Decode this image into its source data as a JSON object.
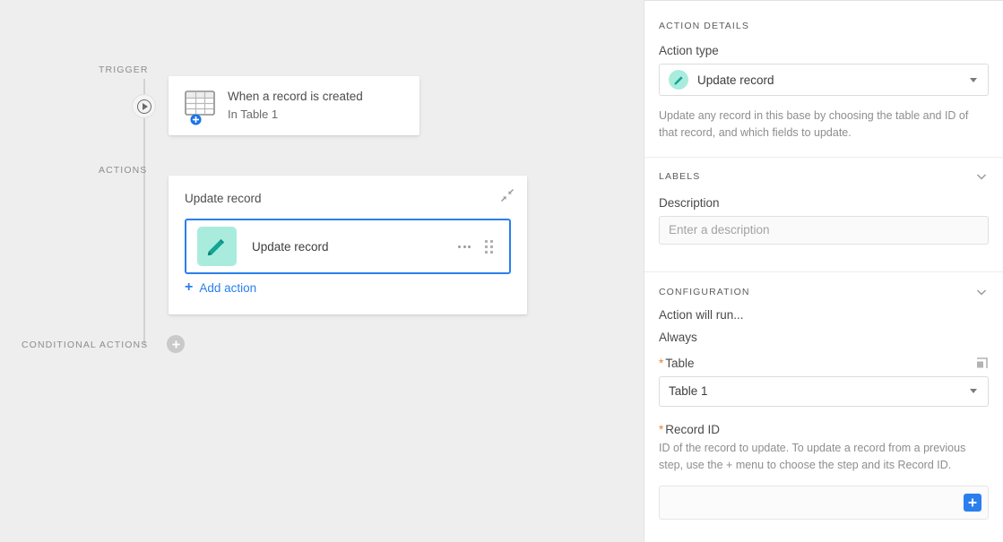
{
  "canvas": {
    "labels": {
      "trigger": "TRIGGER",
      "actions": "ACTIONS",
      "conditional_actions": "CONDITIONAL ACTIONS"
    },
    "trigger_card": {
      "title": "When a record is created",
      "subtitle": "In Table 1",
      "icon": "table-grid-icon",
      "badge_icon": "plus-badge-icon"
    },
    "action_group": {
      "title": "Update record",
      "collapse_icon": "collapse-diagonal-icon",
      "item": {
        "label": "Update record",
        "icon": "pencil-icon",
        "more_icon": "ellipsis-icon",
        "drag_icon": "drag-handle-icon"
      },
      "add_action_label": "Add action",
      "add_action_icon": "plus-icon"
    },
    "conditional_add_icon": "plus-circle-icon",
    "trigger_node_icon": "play-circle-icon"
  },
  "panel": {
    "action_details": {
      "heading": "ACTION DETAILS",
      "action_type_label": "Action type",
      "action_type_value": "Update record",
      "action_type_icon": "pencil-icon",
      "dropdown_icon": "chevron-down-icon",
      "description_text": "Update any record in this base by choosing the table and ID of that record, and which fields to update."
    },
    "labels_section": {
      "heading": "LABELS",
      "collapse_icon": "chevron-down-icon",
      "description_label": "Description",
      "description_value": "",
      "description_placeholder": "Enter a description"
    },
    "configuration": {
      "heading": "CONFIGURATION",
      "collapse_icon": "chevron-down-icon",
      "action_will_run_label": "Action will run...",
      "action_will_run_value": "Always",
      "table_label": "Table",
      "table_required_marker": "*",
      "table_value": "Table 1",
      "table_expand_icon": "external-expand-icon",
      "record_id_label": "Record ID",
      "record_id_required_marker": "*",
      "record_id_help": "ID of the record to update. To update a record from a previous step, use the + menu to choose the step and its Record ID.",
      "record_id_value": "",
      "record_id_plus_icon": "plus-icon"
    }
  },
  "colors": {
    "accent_blue": "#2a7fee",
    "teal": "#1aab95",
    "mint": "#a9ecdd",
    "required_orange": "#e8833a",
    "canvas_bg": "#eeeeee"
  }
}
